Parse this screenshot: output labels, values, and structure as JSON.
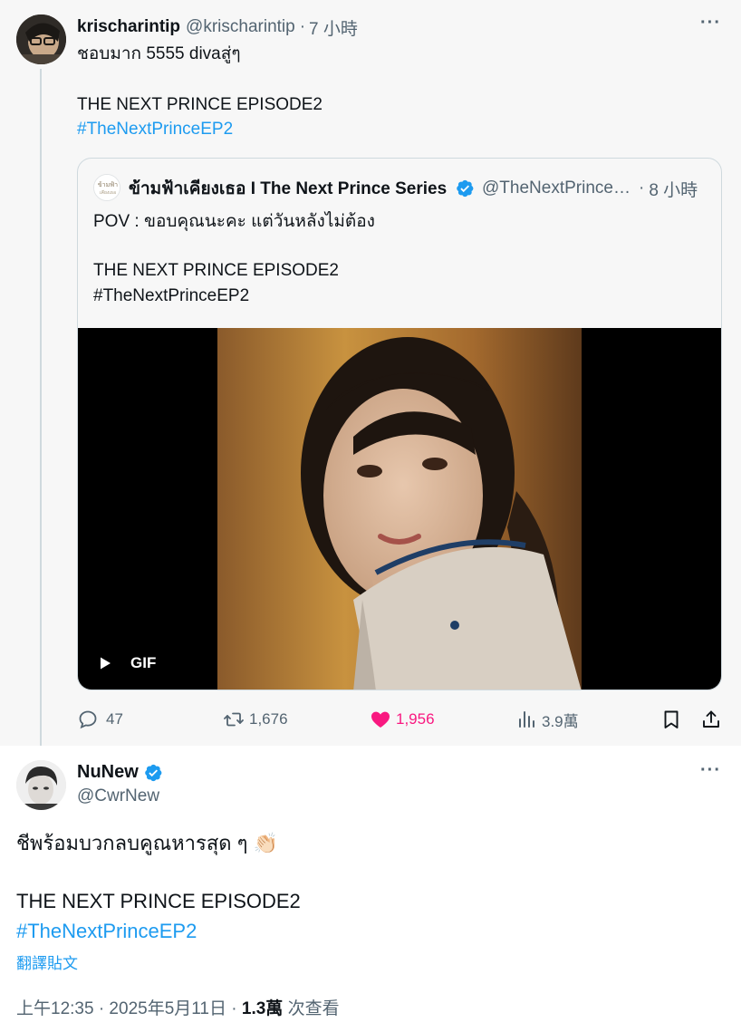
{
  "thread_post": {
    "display_name": "krischarintip",
    "handle": "@krischarintip",
    "separator": "·",
    "time": "7 小時",
    "line1": "ชอบมาก 5555 divaสู่ๆ",
    "line2": "THE NEXT PRINCE EPISODE2",
    "hashtag": "#TheNextPrinceEP2",
    "quote": {
      "display_name": "ข้ามฟ้าเคียงเธอ I The Next Prince Series",
      "handle": "@TheNextPrinceSeries",
      "separator": "·",
      "time": "8 小時",
      "line1": "POV : ขอบคุณนะคะ แต่วันหลังไม่ต้อง",
      "line2": "THE NEXT PRINCE EPISODE2",
      "line3": "#TheNextPrinceEP2",
      "media_badge": "GIF"
    },
    "actions": {
      "replies": "47",
      "reposts": "1,676",
      "likes": "1,956",
      "views": "3.9萬"
    }
  },
  "main_post": {
    "display_name": "NuNew",
    "handle": "@CwrNew",
    "line1": "ชีพร้อมบวกลบคูณหารสุด ๆ 👏🏻",
    "line2": "THE NEXT PRINCE EPISODE2",
    "hashtag": "#TheNextPrinceEP2",
    "translate_label": "翻譯貼文",
    "timestamp": "上午12:35 · 2025年5月11日 · ",
    "views_count": "1.3萬",
    "views_label": " 次查看"
  },
  "colors": {
    "accent_blue": "#1d9bf0",
    "like_pink": "#f91880",
    "muted_text": "#536471",
    "thread_background": "#f7f7f7"
  },
  "icons": [
    "more-icon",
    "verified-badge-icon",
    "play-icon",
    "reply-icon",
    "repost-icon",
    "like-icon",
    "views-icon",
    "bookmark-icon",
    "share-icon"
  ]
}
